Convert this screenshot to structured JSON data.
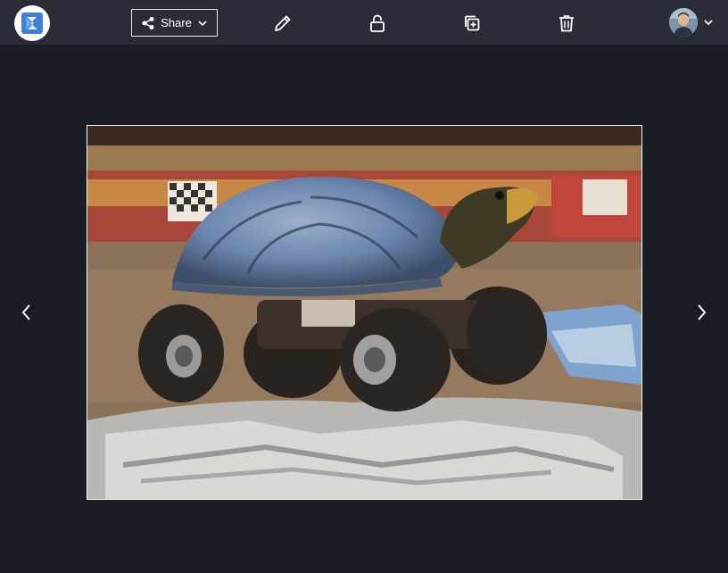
{
  "toolbar": {
    "logo_icon": "app-logo-icon",
    "share_label": "Share",
    "share_icon": "share-nodes-icon",
    "share_caret_icon": "chevron-down-icon",
    "edit_icon": "pencil-icon",
    "lock_icon": "lock-icon",
    "duplicate_icon": "copy-plus-icon",
    "delete_icon": "trash-icon",
    "user_caret_icon": "chevron-down-icon"
  },
  "viewer": {
    "image_subject": "turtle-monster-truck",
    "prev_icon": "chevron-left-icon",
    "next_icon": "chevron-right-icon"
  },
  "colors": {
    "topbar": "#2a2d37",
    "background": "#1b1d26",
    "logo_blue": "#3d7fd9",
    "icon": "#ffffff"
  }
}
